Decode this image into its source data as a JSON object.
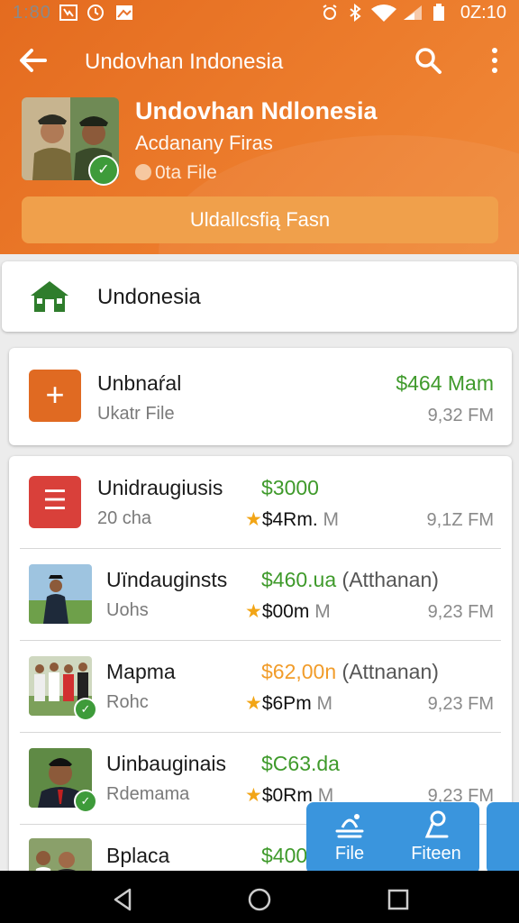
{
  "status_bar": {
    "time": "1:80",
    "clock": "0Z:10"
  },
  "appbar": {
    "title": "Undovhan Indonesia"
  },
  "profile": {
    "name": "Undovhan Ndlonesia",
    "subtitle": "Acdanany Firas",
    "file_info": "0ta File",
    "action_button": "Uldallcsfią Fasn"
  },
  "home_card": {
    "label": "Undonesia"
  },
  "top_item": {
    "title": "Unbnaŕal",
    "subtitle": "Ukatr File",
    "amount": "$464 Mam",
    "time": "9,32 FM"
  },
  "list": [
    {
      "title": "Unidraugiusis",
      "subtitle": "20 cha",
      "amount": "$3000",
      "amount_extra": "",
      "price": "$4Rm.",
      "price_unit": "M",
      "time": "9,1Z FM"
    },
    {
      "title": "Uïndauginsts",
      "subtitle": "Uohs",
      "amount": "$460.ua",
      "amount_extra": "(Atthanan)",
      "price": "$00m",
      "price_unit": "M",
      "time": "9,23 FM"
    },
    {
      "title": "Mapma",
      "subtitle": "Rohc",
      "amount": "$62,00n",
      "amount_extra": "(Attnanan)",
      "price": "$6Pm",
      "price_unit": "M",
      "time": "9,23 FM"
    },
    {
      "title": "Uinbauginais",
      "subtitle": "Rdemama",
      "amount": "$C63.da",
      "amount_extra": "",
      "price": "$0Rm",
      "price_unit": "M",
      "time": "9,23 FM"
    },
    {
      "title": "Bplaca",
      "subtitle": "",
      "amount": "$400",
      "amount_extra": "",
      "price": "",
      "price_unit": "",
      "time": ""
    }
  ],
  "fab": {
    "file_label": "File",
    "fifteen_label": "Fiteen"
  },
  "colors": {
    "header": "#e8722a",
    "accent_green": "#3f9a2b",
    "accent_blue": "#3a95dd",
    "orange_amount": "#f19c2a"
  }
}
